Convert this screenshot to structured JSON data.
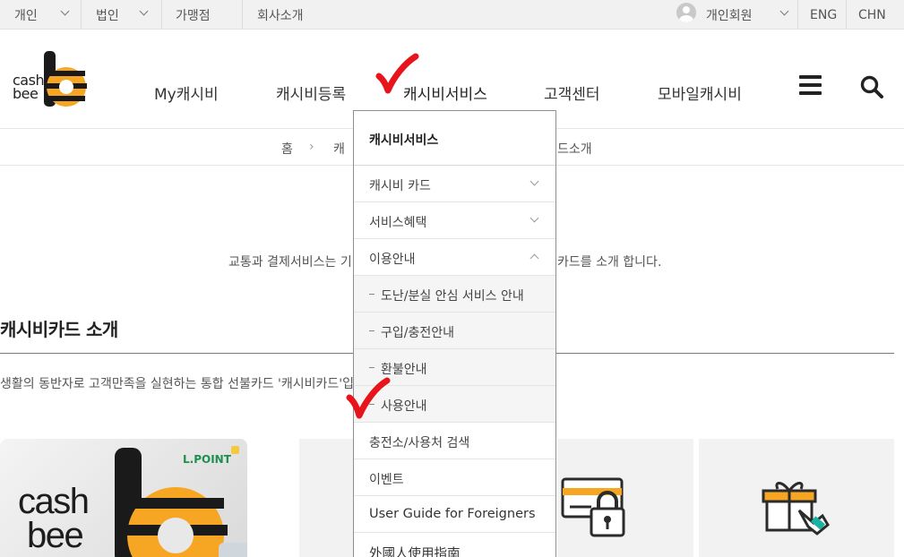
{
  "topbar": {
    "items": [
      {
        "label": "개인"
      },
      {
        "label": "법인"
      },
      {
        "label": "가맹점"
      },
      {
        "label": "회사소개"
      }
    ],
    "member_label": "개인회원",
    "lang_eng": "ENG",
    "lang_chn": "CHN"
  },
  "logo": {
    "line1": "cash",
    "line2": "bee"
  },
  "nav": {
    "items": [
      {
        "label": "My캐시비"
      },
      {
        "label": "캐시비등록"
      },
      {
        "label": "캐시비서비스"
      },
      {
        "label": "고객센터"
      },
      {
        "label": "모바일캐시비"
      }
    ]
  },
  "breadcrumb": {
    "home": "홈",
    "sep": "›",
    "level1": "캐",
    "current": "드소개"
  },
  "intro": {
    "left": "교통과 결제서비스는 기",
    "right": "카드를 소개 합니다."
  },
  "section": {
    "title": "캐시비카드 소개",
    "desc": "생활의 동반자로 고객만족을 실현하는 통합 선불카드 '캐시비카드'입"
  },
  "card": {
    "brand_line1": "cash",
    "brand_line2": "bee",
    "lpoint": "L.POINT"
  },
  "dropdown": {
    "title": "캐시비서비스",
    "items": [
      {
        "label": "캐시비 카드"
      },
      {
        "label": "서비스혜택"
      },
      {
        "label": "이용안내"
      },
      {
        "label": "도난/분실 안심 서비스 안내"
      },
      {
        "label": "구입/충전안내"
      },
      {
        "label": "환불안내"
      },
      {
        "label": "사용안내"
      },
      {
        "label": "충전소/사용처 검색"
      },
      {
        "label": "이벤트"
      },
      {
        "label": "User Guide for Foreigners"
      },
      {
        "label": "外國人使用指南"
      }
    ]
  },
  "colors": {
    "brand_yellow": "#f6a623",
    "brand_black": "#1a1a1a",
    "check_red": "#e8141b",
    "topbar_bg": "#f1f1f1"
  }
}
